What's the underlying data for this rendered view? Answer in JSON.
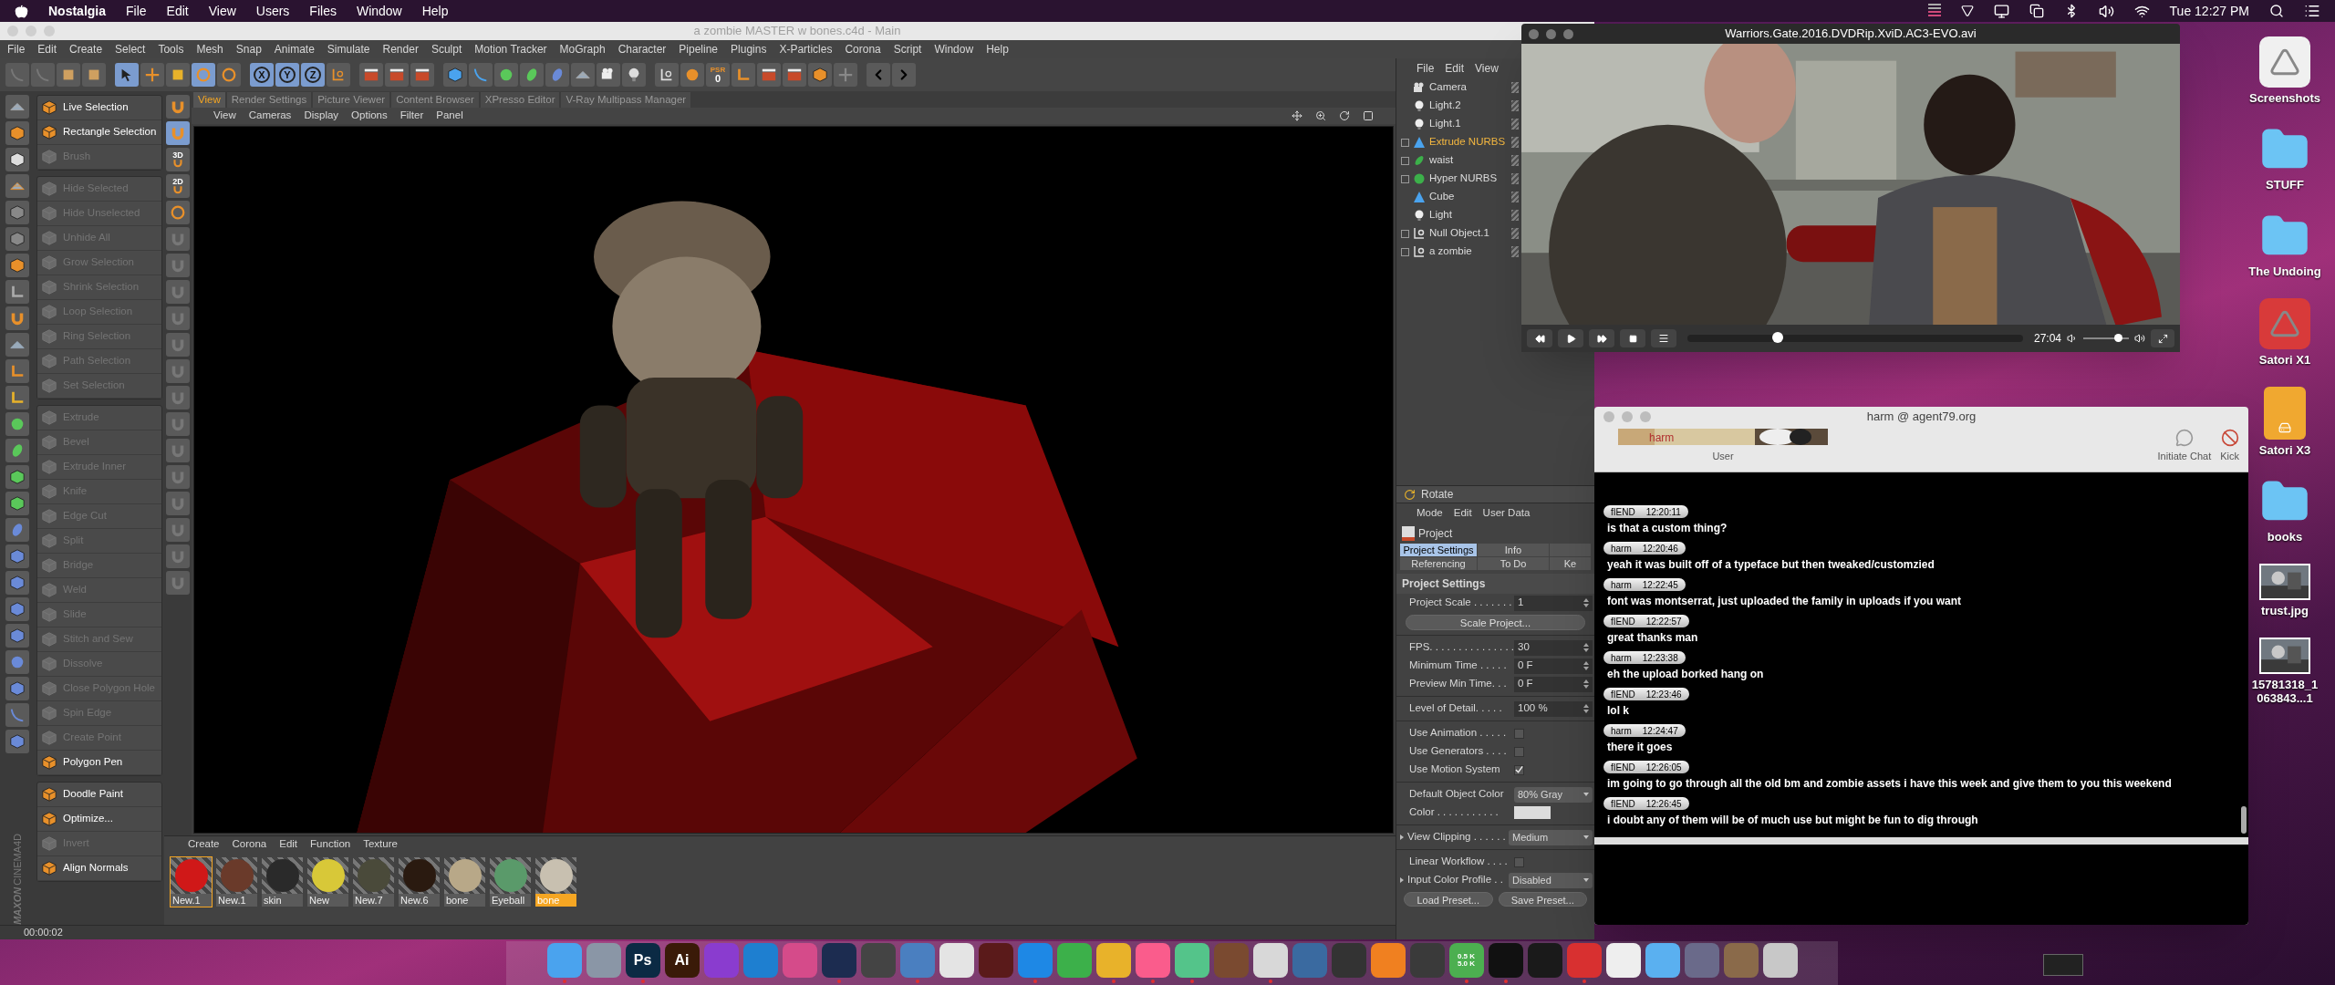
{
  "menubar": {
    "app": "Nostalgia",
    "items": [
      "File",
      "Edit",
      "View",
      "Users",
      "Files",
      "Window",
      "Help"
    ],
    "clock": "Tue 12:27 PM"
  },
  "c4d": {
    "title": "a zombie MASTER w bones.c4d - Main",
    "menu": [
      "File",
      "Edit",
      "Create",
      "Select",
      "Tools",
      "Mesh",
      "Snap",
      "Animate",
      "Simulate",
      "Render",
      "Sculpt",
      "Motion Tracker",
      "MoGraph",
      "Character",
      "Pipeline",
      "Plugins",
      "X-Particles",
      "Corona",
      "Script",
      "Window",
      "Help"
    ],
    "axis_buttons": [
      {
        "label": "X",
        "on": true
      },
      {
        "label": "Y",
        "on": true
      },
      {
        "label": "Z",
        "on": true
      }
    ],
    "psr": {
      "label": "PSR",
      "value": "0"
    },
    "logo": [
      "MAXON",
      "CINEMA4D"
    ],
    "snap_labels": [
      "3D",
      "2D"
    ],
    "command_groups": [
      {
        "items": [
          {
            "label": "Live Selection",
            "disabled": false
          },
          {
            "label": "Rectangle Selection",
            "disabled": false
          },
          {
            "label": "Brush",
            "disabled": true
          }
        ]
      },
      {
        "items": [
          {
            "label": "Hide Selected",
            "disabled": true
          },
          {
            "label": "Hide Unselected",
            "disabled": true
          },
          {
            "label": "Unhide All",
            "disabled": true
          },
          {
            "label": "Grow Selection",
            "disabled": true
          },
          {
            "label": "Shrink Selection",
            "disabled": true
          },
          {
            "label": "Loop Selection",
            "disabled": true
          },
          {
            "label": "Ring Selection",
            "disabled": true
          },
          {
            "label": "Path Selection",
            "disabled": true
          },
          {
            "label": "Set Selection",
            "disabled": true
          }
        ]
      },
      {
        "items": [
          {
            "label": "Extrude",
            "disabled": true
          },
          {
            "label": "Bevel",
            "disabled": true
          },
          {
            "label": "Extrude Inner",
            "disabled": true
          },
          {
            "label": "Knife",
            "disabled": true
          },
          {
            "label": "Edge Cut",
            "disabled": true
          },
          {
            "label": "Split",
            "disabled": true
          },
          {
            "label": "Bridge",
            "disabled": true
          },
          {
            "label": "Weld",
            "disabled": true
          },
          {
            "label": "Slide",
            "disabled": true
          },
          {
            "label": "Stitch and Sew",
            "disabled": true
          },
          {
            "label": "Dissolve",
            "disabled": true
          },
          {
            "label": "Close Polygon Hole",
            "disabled": true
          },
          {
            "label": "Spin Edge",
            "disabled": true
          },
          {
            "label": "Create Point",
            "disabled": true
          },
          {
            "label": "Polygon Pen",
            "disabled": false
          }
        ]
      },
      {
        "items": [
          {
            "label": "Doodle Paint",
            "disabled": false
          },
          {
            "label": "Optimize...",
            "disabled": false
          },
          {
            "label": "Invert",
            "disabled": true
          },
          {
            "label": "Align Normals",
            "disabled": false
          }
        ]
      }
    ],
    "tabs": [
      {
        "label": "View",
        "selected": true
      },
      {
        "label": "Render Settings",
        "selected": false
      },
      {
        "label": "Picture Viewer",
        "selected": false
      },
      {
        "label": "Content Browser",
        "selected": false
      },
      {
        "label": "XPresso Editor",
        "selected": false
      },
      {
        "label": "V-Ray Multipass Manager",
        "selected": false
      }
    ],
    "view_menu": [
      "View",
      "Cameras",
      "Display",
      "Options",
      "Filter",
      "Panel"
    ],
    "material_menu": [
      "Create",
      "Corona",
      "Edit",
      "Function",
      "Texture"
    ],
    "materials": [
      {
        "name": "New.1",
        "color": "#d01818",
        "selected": true,
        "active": false
      },
      {
        "name": "New.1",
        "color": "#6a3a2a",
        "selected": false,
        "active": false
      },
      {
        "name": "skin",
        "color": "#2a2a2a",
        "selected": false,
        "active": false
      },
      {
        "name": "New",
        "color": "#d8c838",
        "selected": false,
        "active": false
      },
      {
        "name": "New.7",
        "color": "#4a4a3a",
        "selected": false,
        "active": false
      },
      {
        "name": "New.6",
        "color": "#2a1a10",
        "selected": false,
        "active": false
      },
      {
        "name": "bone",
        "color": "#b8a888",
        "selected": false,
        "active": false
      },
      {
        "name": "Eyeball",
        "color": "#5a9a6a",
        "selected": false,
        "active": false
      },
      {
        "name": "bone",
        "color": "#c8c0b0",
        "selected": false,
        "active": true
      }
    ],
    "status": "00:00:02",
    "object_menu": [
      "File",
      "Edit",
      "View"
    ],
    "objects": [
      {
        "name": "Camera",
        "kind": "camera",
        "selected": false
      },
      {
        "name": "Light.2",
        "kind": "light",
        "selected": false
      },
      {
        "name": "Light.1",
        "kind": "light",
        "selected": false
      },
      {
        "name": "Extrude NURBS",
        "kind": "nurbs",
        "expanded": false,
        "selected": true
      },
      {
        "name": "waist",
        "kind": "bone",
        "expanded": false,
        "selected": false
      },
      {
        "name": "Hyper NURBS",
        "kind": "hyper",
        "expanded": false,
        "selected": false
      },
      {
        "name": "Cube",
        "kind": "nurbs",
        "selected": false
      },
      {
        "name": "Light",
        "kind": "spot",
        "selected": false
      },
      {
        "name": "Null Object.1",
        "kind": "null",
        "expanded": false,
        "selected": false
      },
      {
        "name": "a zombie",
        "kind": "null",
        "expanded": false,
        "selected": false
      }
    ],
    "tool_bar": {
      "label": "Rotate"
    },
    "attr_menu": [
      "Mode",
      "Edit",
      "User Data"
    ],
    "attr_title": "Project",
    "attr_tabs": [
      {
        "label": "Project Settings",
        "selected": true
      },
      {
        "label": "Info",
        "selected": false
      },
      {
        "label": "Referencing",
        "selected": false
      },
      {
        "label": "To Do",
        "selected": false
      },
      {
        "label": "Ke",
        "selected": false
      }
    ],
    "attr_section": "Project Settings",
    "attr_rows": [
      {
        "kind": "field",
        "label": "Project Scale . . . . . . .",
        "value": "1"
      },
      {
        "kind": "button",
        "label": "Scale Project..."
      },
      {
        "kind": "divider"
      },
      {
        "kind": "field",
        "label": "FPS. . . . . . . . . . . . . . .",
        "value": "30"
      },
      {
        "kind": "field",
        "label": "Minimum Time . . . . .",
        "value": "0 F"
      },
      {
        "kind": "field",
        "label": "Preview Min Time. . .",
        "value": "0 F"
      },
      {
        "kind": "divider"
      },
      {
        "kind": "field",
        "label": "Level of Detail. . . . .",
        "value": "100 %"
      },
      {
        "kind": "divider"
      },
      {
        "kind": "check",
        "label": "Use Animation . . . . .",
        "checked": false
      },
      {
        "kind": "check",
        "label": "Use Generators . . . .",
        "checked": false
      },
      {
        "kind": "check",
        "label": "Use Motion System",
        "checked": true
      },
      {
        "kind": "divider"
      },
      {
        "kind": "select",
        "label": "Default Object Color",
        "value": "80% Gray"
      },
      {
        "kind": "color",
        "label": "Color . . . . . . . . . . .",
        "color": "#dcdcdc"
      },
      {
        "kind": "divider"
      },
      {
        "kind": "group_select",
        "label": "View Clipping . . . . . .",
        "value": "Medium"
      },
      {
        "kind": "divider"
      },
      {
        "kind": "check",
        "label": "Linear Workflow . . . .",
        "checked": false
      },
      {
        "kind": "group_select",
        "label": "Input Color Profile . .",
        "value": "Disabled"
      },
      {
        "kind": "buttons",
        "labels": [
          "Load Preset...",
          "Save Preset..."
        ]
      }
    ]
  },
  "player": {
    "title": "Warriors.Gate.2016.DVDRip.XviD.AC3-EVO.avi",
    "time": "27:04",
    "progress": {
      "level": 0.27
    },
    "volume": {
      "level": 0.75
    }
  },
  "chat": {
    "title": "harm @ agent79.org",
    "user_name": "harm",
    "user_label": "User",
    "actions": [
      "Initiate Chat",
      "Kick"
    ],
    "messages": [
      {
        "user": "fIEND",
        "time": "12:20:11",
        "text": "is that a custom thing?"
      },
      {
        "user": "harm",
        "time": "12:20:46",
        "text": "yeah it was built off of a typeface but then tweaked/customzied"
      },
      {
        "user": "harm",
        "time": "12:22:45",
        "text": "font was montserrat, just uploaded the family in uploads if you want"
      },
      {
        "user": "fIEND",
        "time": "12:22:57",
        "text": "great thanks man"
      },
      {
        "user": "harm",
        "time": "12:23:38",
        "text": "eh the upload borked hang on"
      },
      {
        "user": "fIEND",
        "time": "12:23:46",
        "text": "lol k"
      },
      {
        "user": "harm",
        "time": "12:24:47",
        "text": "there it goes"
      },
      {
        "user": "fIEND",
        "time": "12:26:05",
        "text": "im going to go through all the old bm and zombie assets i have this week and give them to you this weekend"
      },
      {
        "user": "fIEND",
        "time": "12:26:45",
        "text": "i doubt any of them will be of much use but might be fun to dig through"
      }
    ]
  },
  "desktop": [
    {
      "kind": "app",
      "label": "Screenshots",
      "color": "#f0f0f0"
    },
    {
      "kind": "folder",
      "label": "STUFF",
      "color": "#6cc4f4"
    },
    {
      "kind": "folder",
      "label": "The Undoing",
      "color": "#6cc4f4"
    },
    {
      "kind": "app",
      "label": "Satori X1",
      "color": "#d83a3a"
    },
    {
      "kind": "drive",
      "label": "Satori X3",
      "color": "#f0a830"
    },
    {
      "kind": "folder",
      "label": "books",
      "color": "#6cc4f4"
    },
    {
      "label": "trust.jpg"
    },
    {
      "label": "15781318_1\n063843...1"
    }
  ],
  "dock": [
    {
      "color": "#4aa3ee",
      "running": true
    },
    {
      "color": "#8a96a6",
      "running": false
    },
    {
      "color": "#0b2a44",
      "running": true,
      "labels": [
        "Ps"
      ]
    },
    {
      "color": "#3a1a08",
      "running": false,
      "labels": [
        "Ai"
      ]
    },
    {
      "color": "#8a3ccf",
      "running": false
    },
    {
      "color": "#1e7fd0",
      "running": false
    },
    {
      "color": "#d54b8a",
      "running": false
    },
    {
      "color": "#1c2c50",
      "running": true
    },
    {
      "color": "#444444",
      "running": false
    },
    {
      "color": "#4a7fc0",
      "running": true
    },
    {
      "color": "#e4e4e4",
      "running": false
    },
    {
      "color": "#5a1a1a",
      "running": false
    },
    {
      "color": "#1e88e5",
      "running": true
    },
    {
      "color": "#3cb04a",
      "running": false
    },
    {
      "color": "#e8b22a",
      "running": true
    },
    {
      "color": "#fa5c8c",
      "running": true
    },
    {
      "color": "#54c48a",
      "running": true
    },
    {
      "color": "#7a4a30",
      "running": false
    },
    {
      "color": "#d8d8d8",
      "running": true
    },
    {
      "color": "#3a6aa0",
      "running": false
    },
    {
      "color": "#333333",
      "running": false
    },
    {
      "color": "#f08020",
      "running": false
    },
    {
      "color": "#3a3a3a",
      "running": false
    },
    {
      "color": "#4caf50",
      "running": true,
      "labels": [
        "0.5 K",
        "5.0 K"
      ]
    },
    {
      "color": "#111111",
      "running": true
    },
    {
      "color": "#1a1a1a",
      "running": false
    },
    {
      "color": "#d83030",
      "running": true
    },
    {
      "color": "#eeeeee",
      "running": false
    },
    {
      "color": "#5ab0f0",
      "running": false
    },
    {
      "color": "#6a6a8a",
      "running": false
    },
    {
      "color": "#8a6a4a",
      "running": false
    },
    {
      "color": "#c8c8c8",
      "running": false
    }
  ]
}
